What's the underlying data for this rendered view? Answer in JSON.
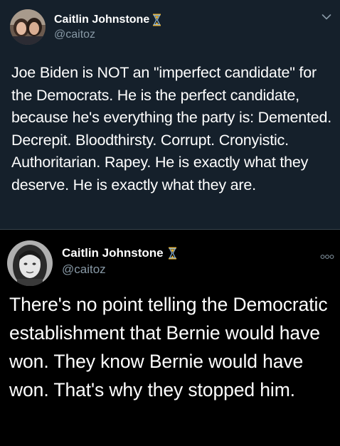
{
  "tweets": [
    {
      "display_name": "Caitlin Johnstone",
      "handle": "@caitoz",
      "text": "Joe Biden is NOT an \"imperfect candidate\" for the Democrats. He is the perfect candidate, because he's everything the party is: Demented. Decrepit. Bloodthirsty. Corrupt. Cronyistic. Authoritarian. Rapey. He is exactly what they deserve. He is exactly what they are.",
      "badge_icon": "hourglass-icon",
      "menu_icon": "chevron-down-icon"
    },
    {
      "display_name": "Caitlin Johnstone",
      "handle": "@caitoz",
      "text": "There's no point telling the Democratic establishment that Bernie would have won. They know Bernie would have won. That's why they stopped him.",
      "badge_icon": "hourglass-icon",
      "menu_icon": "more-options-icon"
    }
  ],
  "colors": {
    "background": "#15202b",
    "background_second": "#000000",
    "secondary_text": "#8899a6",
    "divider": "#38444d",
    "hourglass": "#e8b030"
  }
}
